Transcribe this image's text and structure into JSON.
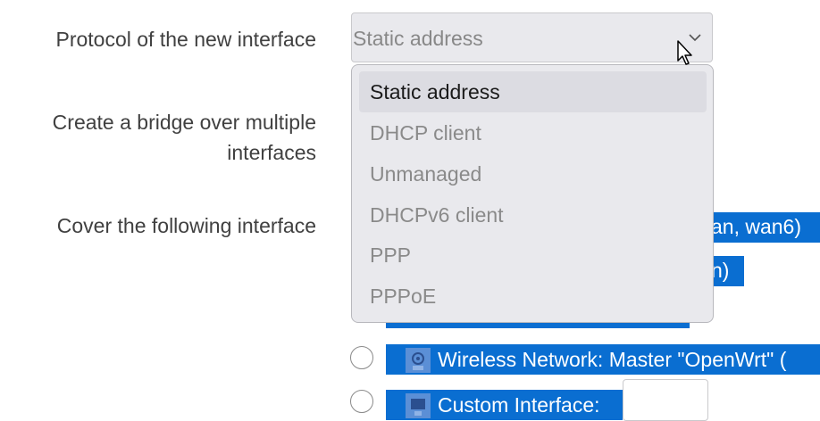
{
  "form": {
    "protocol_label": "Protocol of the new interface",
    "bridge_label": "Create a bridge over multiple interfaces",
    "cover_label": "Cover the following interface"
  },
  "protocol_select": {
    "value": "Static address",
    "options": [
      {
        "label": "Static address",
        "selected": true
      },
      {
        "label": "DHCP client",
        "selected": false
      },
      {
        "label": "Unmanaged",
        "selected": false
      },
      {
        "label": "DHCPv6 client",
        "selected": false
      },
      {
        "label": "PPP",
        "selected": false
      },
      {
        "label": "PPPoE",
        "selected": false
      }
    ]
  },
  "interfaces": {
    "partial_1": "an, wan6)",
    "partial_2": "n)",
    "wireless": "Wireless Network: Master \"OpenWrt\" (",
    "custom": "Custom Interface:"
  },
  "colors": {
    "highlight": "#0a6ed1",
    "select_bg": "#e9e9ed"
  }
}
